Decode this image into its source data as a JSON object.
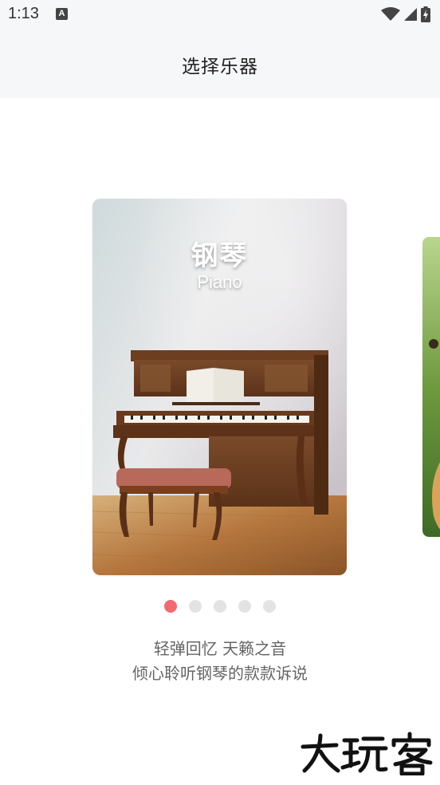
{
  "status_bar": {
    "time": "1:13",
    "notification_icon": "A",
    "icons": [
      "wifi-icon",
      "signal-icon",
      "battery-charging-icon"
    ]
  },
  "header": {
    "title": "选择乐器"
  },
  "carousel": {
    "current_card": {
      "title": "钢琴",
      "subtitle": "Piano",
      "image": "piano-photo"
    },
    "next_card": {
      "image": "guitar-photo"
    },
    "page_count": 5,
    "active_index": 0
  },
  "description": {
    "line1": "轻弹回忆 天籁之音",
    "line2": "倾心聆听钢琴的款款诉说"
  },
  "watermark": {
    "text": "大玩客"
  },
  "colors": {
    "accent": "#f06a6f",
    "dot_inactive": "#e3e3e3",
    "header_bg": "#f6f7f9",
    "text_muted": "#666666"
  }
}
